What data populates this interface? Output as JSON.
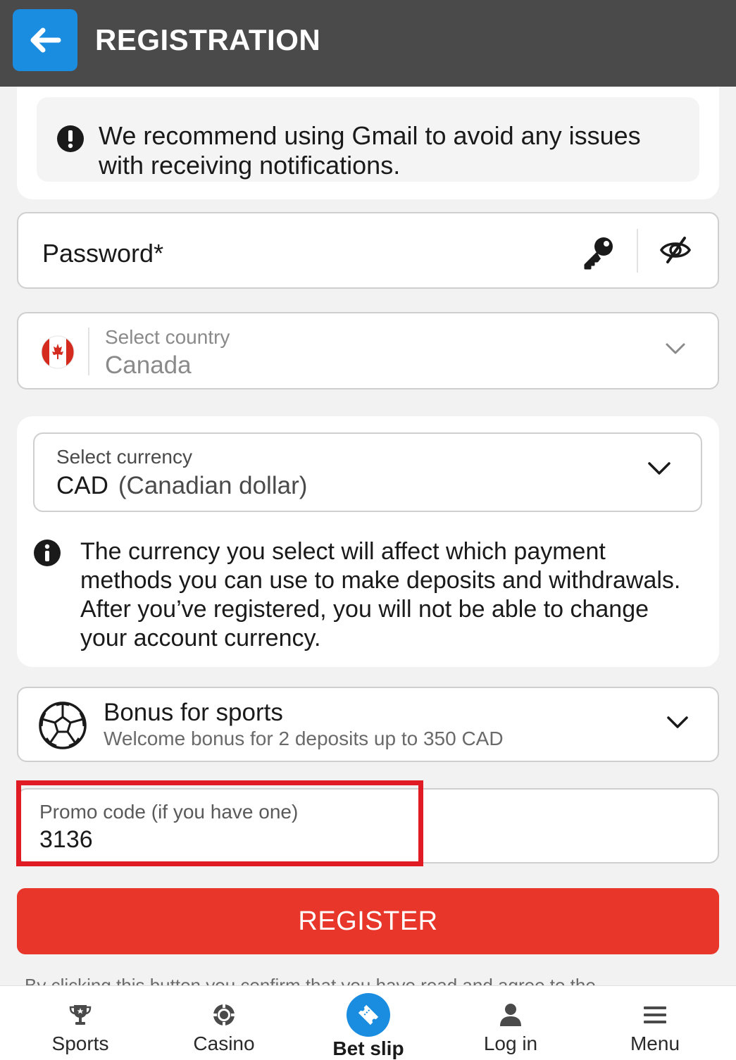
{
  "header": {
    "title": "REGISTRATION",
    "back_icon": "arrow-left-icon",
    "accent_color": "#1a8de0"
  },
  "notice": {
    "icon": "exclamation-circle-icon",
    "text": "We recommend using Gmail to avoid any issues with receiving notifications."
  },
  "password": {
    "label": "Password*",
    "icons": [
      "key-icon",
      "eye-off-icon"
    ]
  },
  "country": {
    "label": "Select country",
    "value": "Canada",
    "flag_icon": "canada-flag-icon"
  },
  "currency": {
    "label": "Select currency",
    "code": "CAD",
    "name": "(Canadian dollar)",
    "info_text": "The currency you select will affect which payment methods you can use to make deposits and withdrawals. After you’ve registered, you will not be able to change your account currency."
  },
  "bonus": {
    "title": "Bonus for sports",
    "subtitle": "Welcome bonus for 2 deposits up to 350 CAD",
    "icon": "soccer-ball-icon"
  },
  "promo": {
    "label": "Promo code (if you have one)",
    "value": "3136",
    "highlight_color": "#e01b24"
  },
  "register": {
    "label": "REGISTER",
    "color": "#e8362a"
  },
  "disclaimer": "By clicking this button you confirm that you have read and agree to the",
  "bottom_nav": {
    "items": [
      {
        "label": "Sports",
        "icon": "trophy-icon"
      },
      {
        "label": "Casino",
        "icon": "casino-chip-icon"
      },
      {
        "label": "Bet slip",
        "icon": "ticket-icon"
      },
      {
        "label": "Log in",
        "icon": "user-icon"
      },
      {
        "label": "Menu",
        "icon": "hamburger-menu-icon"
      }
    ]
  }
}
